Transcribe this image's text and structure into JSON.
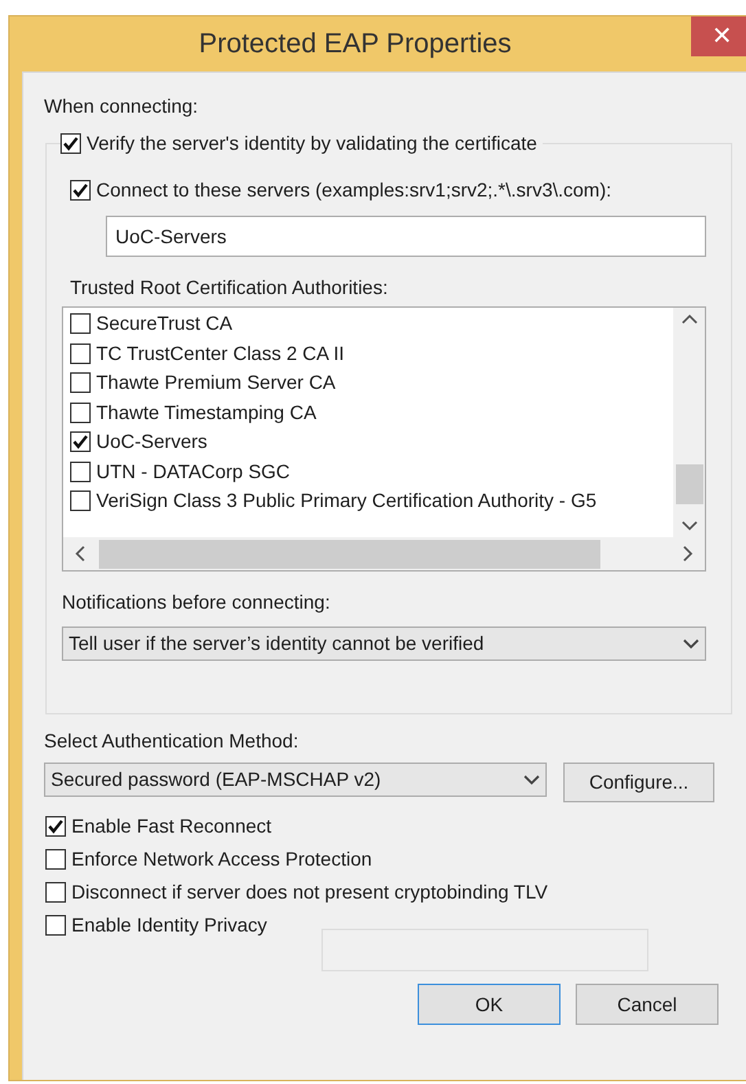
{
  "window": {
    "title": "Protected EAP Properties",
    "close": "✕"
  },
  "when_connecting": {
    "label": "When connecting:",
    "verify": {
      "label": "Verify the server's identity by validating the certificate",
      "checked": true
    },
    "connect_servers": {
      "label": "Connect to these servers (examples:srv1;srv2;.*\\.srv3\\.com):",
      "checked": true
    },
    "servers_field": {
      "value": "UoC-Servers"
    },
    "trusted_roots": {
      "label": "Trusted Root Certification Authorities:",
      "items": [
        {
          "label": "SecureTrust CA",
          "checked": false
        },
        {
          "label": "TC TrustCenter Class 2 CA II",
          "checked": false
        },
        {
          "label": "Thawte Premium Server CA",
          "checked": false
        },
        {
          "label": "Thawte Timestamping CA",
          "checked": false
        },
        {
          "label": "UoC-Servers",
          "checked": true
        },
        {
          "label": "UTN - DATACorp SGC",
          "checked": false
        },
        {
          "label": "VeriSign Class 3 Public Primary Certification Authority - G5",
          "checked": false
        }
      ]
    },
    "notifications": {
      "label": "Notifications before connecting:",
      "value": "Tell user if the server’s identity cannot be verified"
    }
  },
  "auth_method": {
    "label": "Select Authentication Method:",
    "value": "Secured password (EAP-MSCHAP v2)",
    "configure": "Configure..."
  },
  "options": [
    {
      "label": "Enable Fast Reconnect",
      "checked": true
    },
    {
      "label": "Enforce Network Access Protection",
      "checked": false
    },
    {
      "label": "Disconnect if server does not present cryptobinding TLV",
      "checked": false
    },
    {
      "label": "Enable Identity Privacy",
      "checked": false
    }
  ],
  "identity_field": {
    "disabled": true
  },
  "buttons": [
    {
      "label": "OK",
      "default": true
    },
    {
      "label": "Cancel",
      "default": false
    }
  ]
}
